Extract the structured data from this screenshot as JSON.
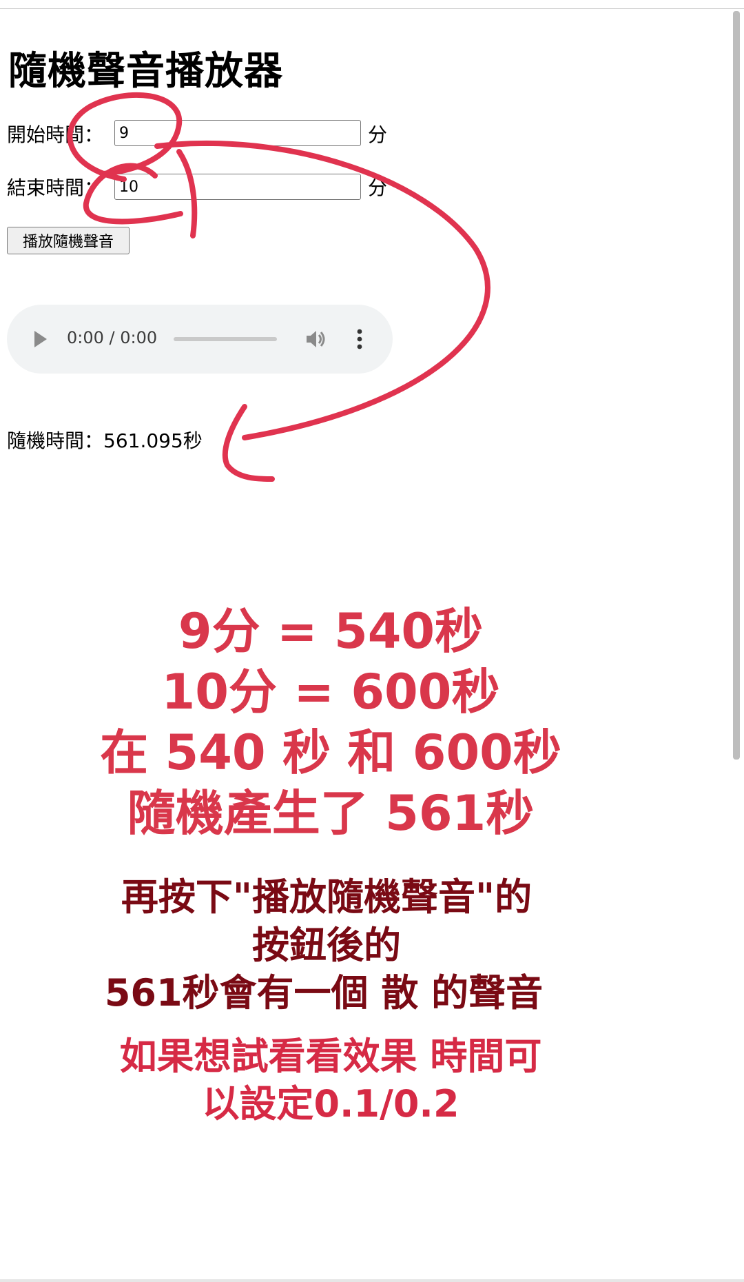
{
  "page": {
    "title": "隨機聲音播放器"
  },
  "form": {
    "start_label": "開始時間：",
    "start_value": "9",
    "end_label": "結束時間：",
    "end_value": "10",
    "unit": "分",
    "play_button_label": "播放隨機聲音"
  },
  "audio": {
    "time": "0:00 / 0:00",
    "progress": 0,
    "icons": {
      "play": "play-icon",
      "volume": "volume-icon",
      "more": "more-vertical-icon"
    }
  },
  "result": {
    "text": "隨機時間：561.095秒"
  },
  "annotation": {
    "line1": "9分 = 540秒",
    "line2": "10分 = 600秒",
    "line3": "在 540 秒 和 600秒",
    "line4": "隨機產生了 561秒",
    "line5": "再按下\"播放隨機聲音\"的",
    "line6": "按鈕後的",
    "line7": "561秒會有一個 散 的聲音",
    "line8": "如果想試看看效果 時間可",
    "line9": "以設定0.1/0.2"
  },
  "colors": {
    "annotation_red": "#d9374b",
    "annotation_dark": "#7a0a14",
    "annotation_pink": "#d62a45",
    "audio_bg": "#f1f3f4"
  }
}
